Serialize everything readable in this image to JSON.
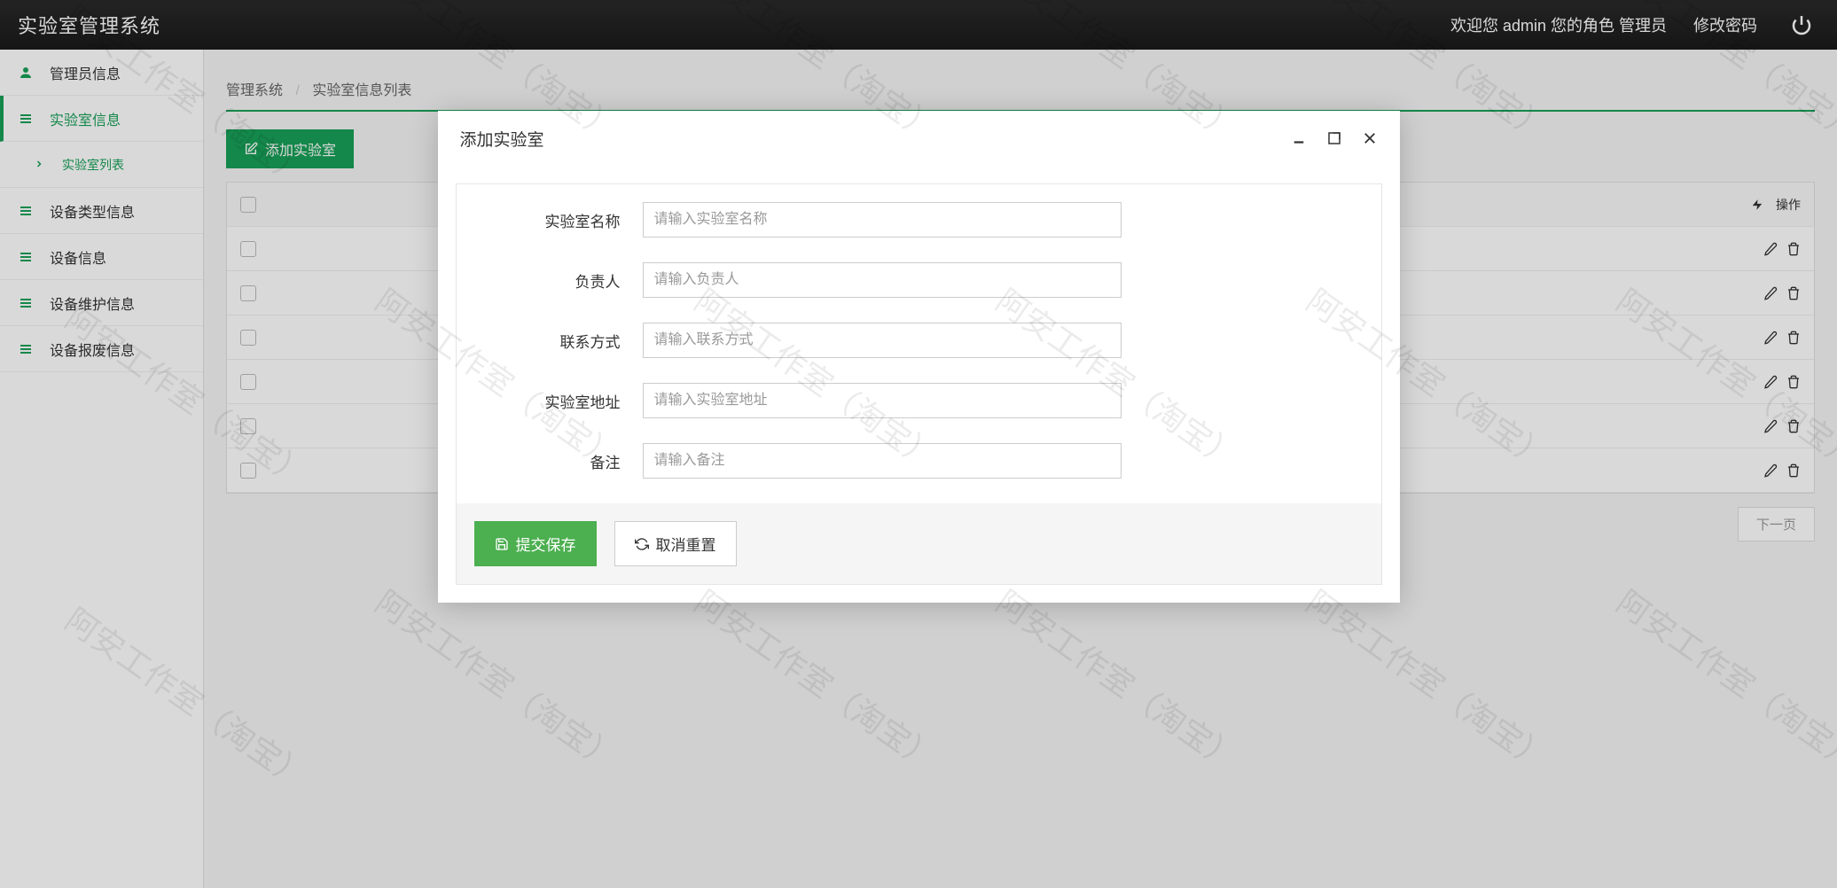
{
  "header": {
    "title": "实验室管理系统",
    "welcome": "欢迎您 admin 您的角色 管理员",
    "change_pw": "修改密码"
  },
  "sidebar": {
    "items": [
      {
        "label": "管理员信息",
        "icon": "admin"
      },
      {
        "label": "实验室信息",
        "icon": "menu",
        "active": true
      },
      {
        "label": "实验室列表",
        "icon": "chevron",
        "sub": true
      },
      {
        "label": "设备类型信息",
        "icon": "menu"
      },
      {
        "label": "设备信息",
        "icon": "menu"
      },
      {
        "label": "设备维护信息",
        "icon": "menu"
      },
      {
        "label": "设备报废信息",
        "icon": "menu"
      }
    ]
  },
  "breadcrumb": {
    "root": "管理系统",
    "current": "实验室信息列表"
  },
  "toolbar": {
    "add_label": "添加实验室"
  },
  "table": {
    "action_header": "操作",
    "rows": 6
  },
  "pagination": {
    "next": "下一页"
  },
  "modal": {
    "title": "添加实验室",
    "fields": {
      "name": {
        "label": "实验室名称",
        "placeholder": "请输入实验室名称"
      },
      "owner": {
        "label": "负责人",
        "placeholder": "请输入负责人"
      },
      "contact": {
        "label": "联系方式",
        "placeholder": "请输入联系方式"
      },
      "address": {
        "label": "实验室地址",
        "placeholder": "请输入实验室地址"
      },
      "remark": {
        "label": "备注",
        "placeholder": "请输入备注"
      }
    },
    "submit": "提交保存",
    "reset": "取消重置"
  },
  "watermark": "阿安工作室（淘宝）"
}
